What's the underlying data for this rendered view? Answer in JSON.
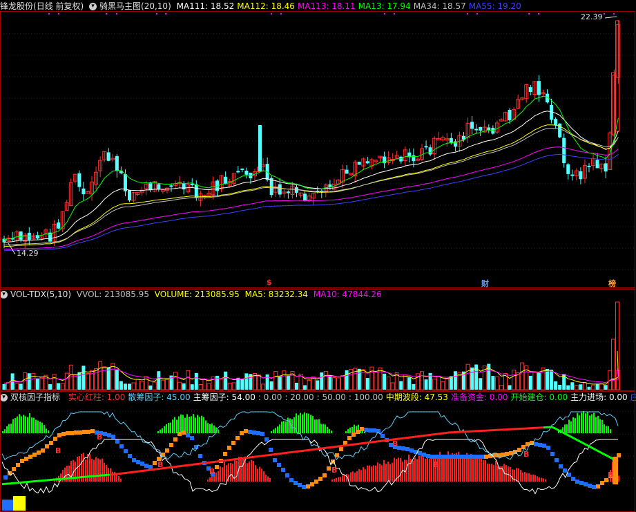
{
  "main_panel": {
    "stock_name": "锋龙股份",
    "period_info": "(日线 前复权)",
    "indicator_name": "骑黑马主图(20,10)",
    "ma_values": [
      {
        "label": "MA111: 18.52",
        "color": "#ffffff"
      },
      {
        "label": "MA112: 18.46",
        "color": "#ffff00"
      },
      {
        "label": "MA113: 18.11",
        "color": "#ff00ff"
      },
      {
        "label": "MA13: 17.94",
        "color": "#00ff00"
      },
      {
        "label": "MA34: 18.57",
        "color": "#c0c0c0"
      },
      {
        "label": "MA55: 19.20",
        "color": "#4040ff"
      }
    ],
    "high_label": "22.39",
    "low_label": "14.29",
    "event_markers": [
      {
        "text": "$",
        "color": "#ff3030"
      },
      {
        "text": "财",
        "color": "#60a0ff"
      },
      {
        "text": "榜",
        "color": "#ffa040"
      }
    ]
  },
  "volume_panel": {
    "indicator_name": "VOL-TDX(5,10)",
    "vvol": "VVOL: 213085.95",
    "volume": "VOLUME: 213085.95",
    "ma5": "MA5: 83232.34",
    "ma10": "MA10: 47844.26",
    "colors": {
      "vvol": "#c0c0c0",
      "volume": "#ffff00",
      "ma5": "#ffff00",
      "ma10": "#ff00ff"
    }
  },
  "factor_panel": {
    "indicator_name": "双核因子指标",
    "items": [
      {
        "label": "实心红柱: 1.00",
        "color": "#ff3030"
      },
      {
        "label": "散筹因子: 45.00",
        "color": "#60d0ff"
      },
      {
        "label": "主筹因子: 54.00",
        "color": "#ffffff"
      },
      {
        "label": ": 0.00",
        "color": "#c0c0c0"
      },
      {
        "label": ": 20.00",
        "color": "#c0c0c0"
      },
      {
        "label": ": 50.00",
        "color": "#c0c0c0"
      },
      {
        "label": ": 100.00",
        "color": "#c0c0c0"
      },
      {
        "label": "中期波段: 47.53",
        "color": "#ffff00"
      },
      {
        "label": "准备资金: 0.00",
        "color": "#ff00ff"
      },
      {
        "label": "开始建仓: 0.00",
        "color": "#00ff00"
      },
      {
        "label": "主力进场: 0.00",
        "color": "#ffffff"
      },
      {
        "label": "庄机共振",
        "color": "#4060ff"
      }
    ],
    "b_marker": "B"
  },
  "colors": {
    "up_candle": "#ff3030",
    "down_candle": "#54ffff",
    "grid": "#8b0000",
    "border": "#a00000"
  }
}
